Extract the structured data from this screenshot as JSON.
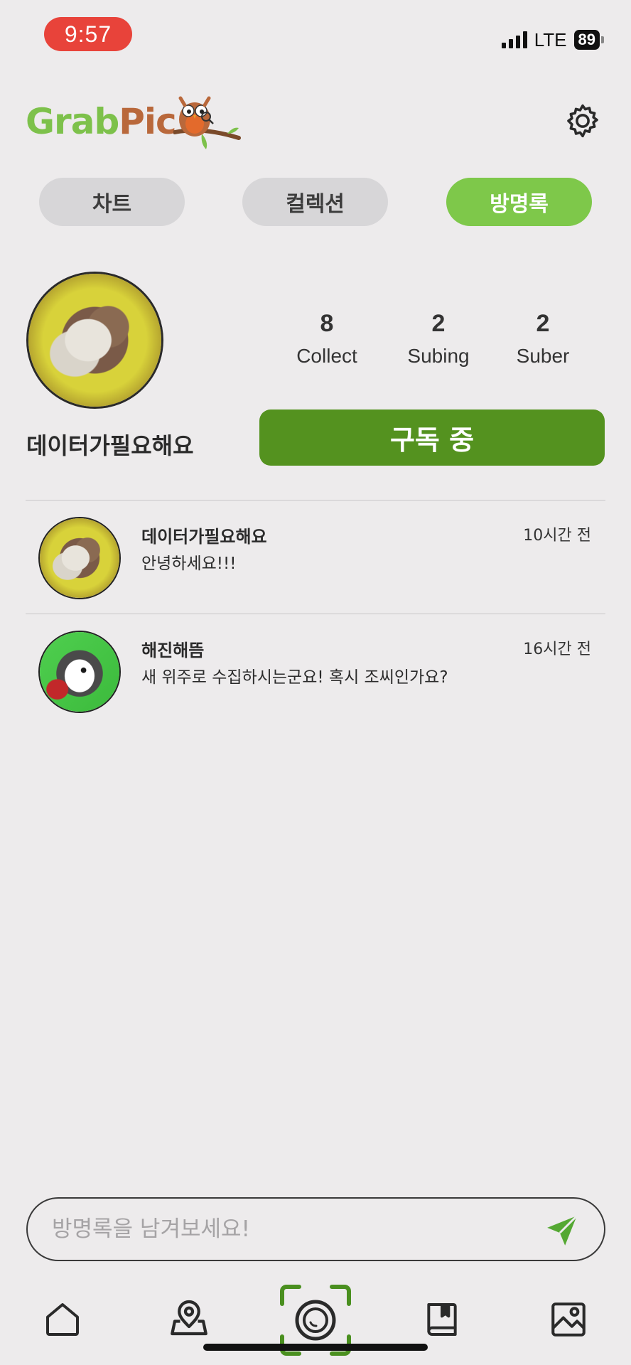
{
  "status_bar": {
    "time": "9:57",
    "network": "LTE",
    "battery": "89"
  },
  "header": {
    "logo_text_green": "Grab",
    "logo_text_brown": "Pic"
  },
  "tabs": [
    {
      "label": "차트",
      "active": false
    },
    {
      "label": "컬렉션",
      "active": false
    },
    {
      "label": "방명록",
      "active": true
    }
  ],
  "profile": {
    "username": "데이터가필요해요",
    "stats": [
      {
        "value": "8",
        "label": "Collect"
      },
      {
        "value": "2",
        "label": "Subing"
      },
      {
        "value": "2",
        "label": "Suber"
      }
    ],
    "subscribe_label": "구독 중"
  },
  "guestbook": [
    {
      "name": "데이터가필요해요",
      "time": "10시간 전",
      "text": "안녕하세요!!!"
    },
    {
      "name": "해진해뜸",
      "time": "16시간 전",
      "text": "새 위주로 수집하시는군요! 혹시 조씨인가요?"
    }
  ],
  "input": {
    "placeholder": "방명록을 남겨보세요!"
  },
  "colors": {
    "accent": "#7ec84a",
    "subscribe": "#54921f",
    "status_time_bg": "#e8433a"
  },
  "nav": [
    "home-icon",
    "map-pin-icon",
    "camera-icon",
    "book-icon",
    "gallery-icon"
  ]
}
